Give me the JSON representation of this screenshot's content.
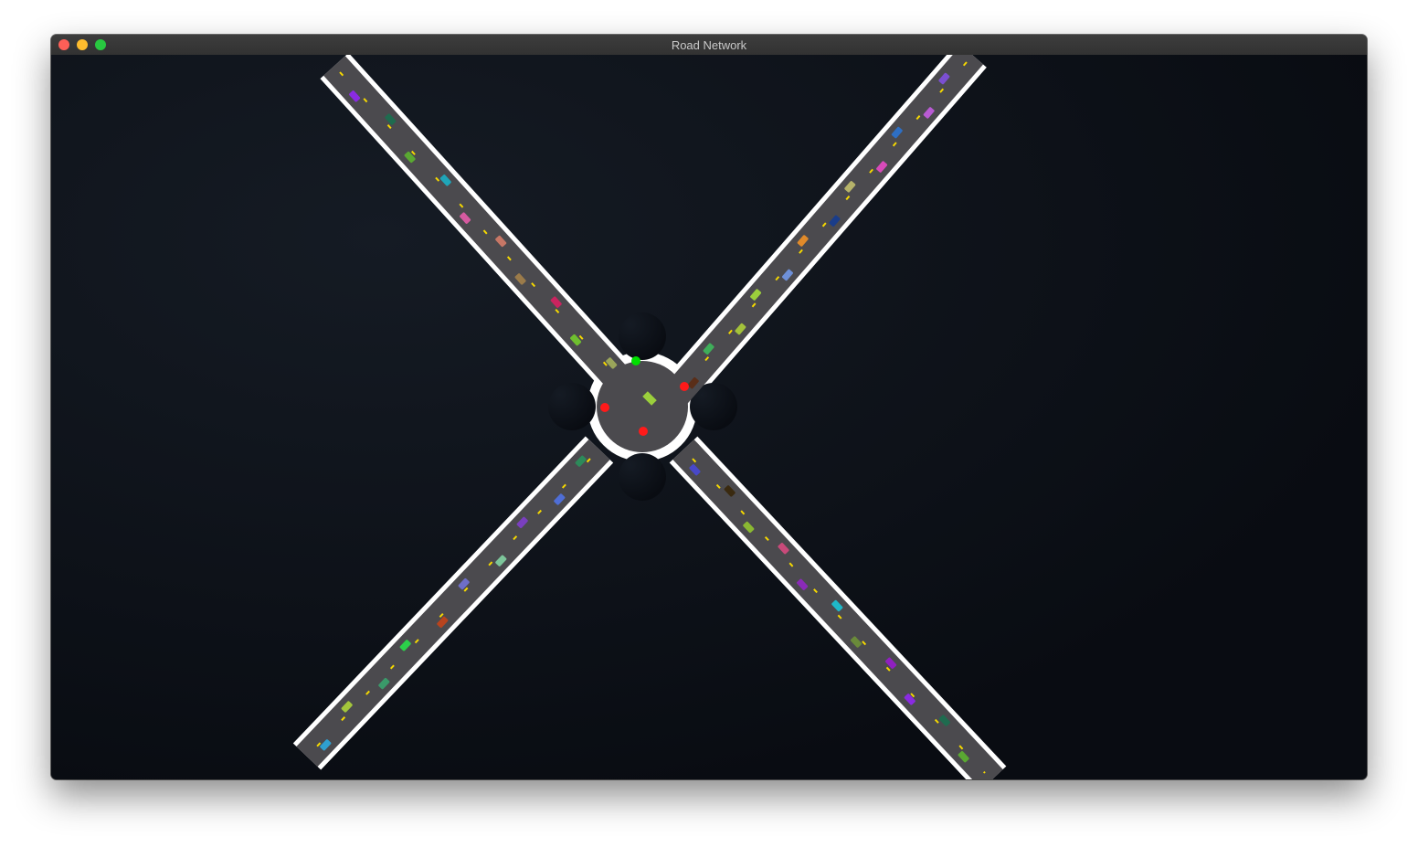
{
  "window": {
    "title": "Road Network",
    "controls": [
      "close-button",
      "minimize-button",
      "zoom-button"
    ]
  },
  "scene": {
    "background": "#0b0f15",
    "road_color": "#4b4a4e",
    "edge_color": "#ffffff",
    "lane_mark_color": "#f5d800",
    "signals": [
      {
        "state": "green",
        "color": "#00e000"
      },
      {
        "state": "red",
        "color": "#ff1a1a"
      },
      {
        "state": "red",
        "color": "#ff1a1a"
      },
      {
        "state": "red",
        "color": "#ff1a1a"
      }
    ],
    "vehicle_colors": [
      "#8a2be2",
      "#1f6b4f",
      "#5aa832",
      "#1fa5b8",
      "#d65aa0",
      "#c77766",
      "#9b7b4a",
      "#c9245f",
      "#6fbf2f",
      "#9aa55a",
      "#7b4fd1",
      "#b85bd3",
      "#2e6fc4",
      "#d84ab9",
      "#b6b36a",
      "#1a3d8a",
      "#e08a2a",
      "#6e90d8",
      "#9bcf3c",
      "#a3c23b",
      "#3fae5a",
      "#5a2e18",
      "#2d8a5a",
      "#4f6ed6",
      "#7a3fbf",
      "#7dc59a",
      "#6e6ec8",
      "#b8441e",
      "#2bd04a",
      "#3a9a6a",
      "#a3c63b",
      "#2fa0d0",
      "#4848c8",
      "#3a2a10",
      "#8ab832",
      "#c84a7a",
      "#8a2bb8",
      "#1fb8c8",
      "#6a8a3a",
      "#9020c0"
    ]
  }
}
